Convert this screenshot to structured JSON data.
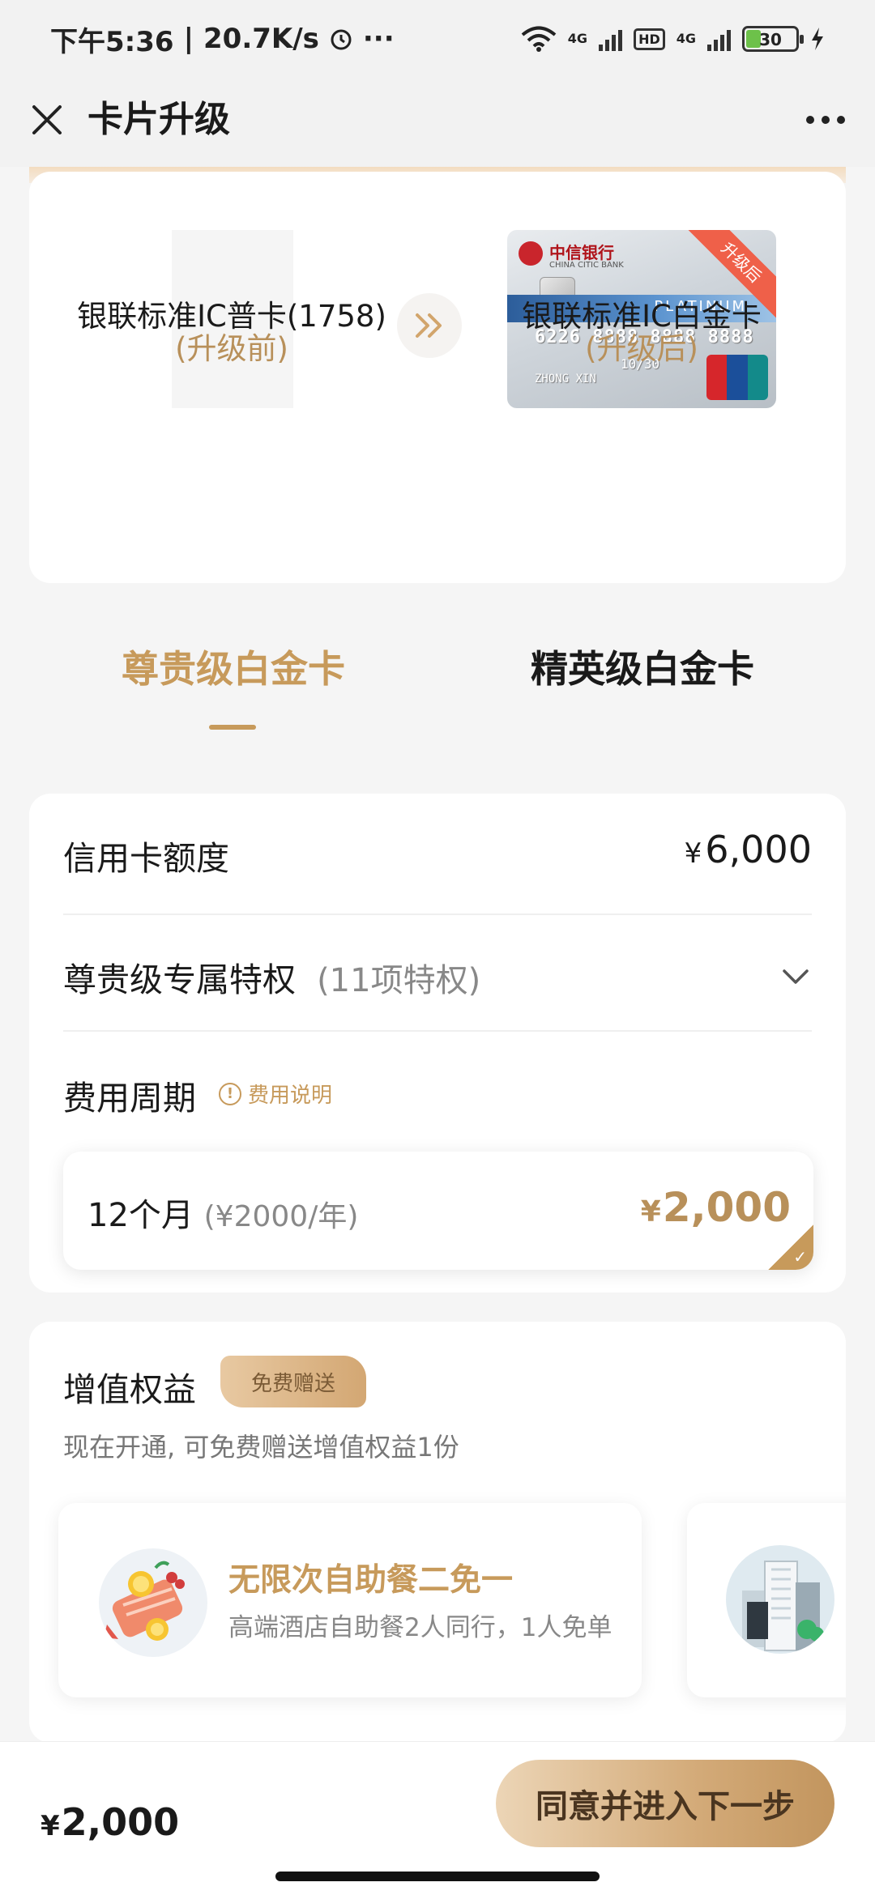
{
  "status_bar": {
    "time": "下午5:36",
    "speed": "20.7K/s",
    "more": "···",
    "net1": "4G",
    "hd": "HD",
    "net2": "4G",
    "battery": "30"
  },
  "nav": {
    "title": "卡片升级"
  },
  "card_compare": {
    "old_card_name": "银联标准IC普卡(1758)",
    "old_card_state": "(升级前)",
    "new_card_name": "银联标准IC白金卡",
    "new_card_state": "(升级后)",
    "new_card_image": {
      "bank_name": "中信银行",
      "bank_sub": "CHINA CITIC BANK",
      "product": "PLATINUM",
      "number": "6226 8888 8888 8888",
      "expiry": "10/30",
      "holder": "ZHONG XIN",
      "corner_tag": "升级后",
      "network": "UnionPay",
      "network_cn": "银联"
    }
  },
  "tabs": [
    {
      "label": "尊贵级白金卡",
      "active": true
    },
    {
      "label": "精英级白金卡",
      "active": false
    }
  ],
  "info": {
    "credit_limit_label": "信用卡额度",
    "credit_limit_currency": "¥",
    "credit_limit_value": "6,000",
    "privilege_label": "尊贵级专属特权",
    "privilege_count": "(11项特权)",
    "fee_period_label": "费用周期",
    "fee_note_label": "费用说明",
    "period_label": "12个月",
    "period_sub": "(¥2000/年)",
    "period_currency": "¥",
    "period_price": "2,000"
  },
  "benefits": {
    "title": "增值权益",
    "badge": "免费赠送",
    "desc": "现在开通, 可免费赠送增值权益1份",
    "items": [
      {
        "title": "无限次自助餐二免一",
        "subtitle": "高端酒店自助餐2人同行，1人免单"
      }
    ]
  },
  "bottom": {
    "total_currency": "¥",
    "total_value": "2,000",
    "next_label": "同意并进入下一步"
  },
  "colors": {
    "accent_gold": "#c79a5b",
    "gold_text": "#b8905a"
  }
}
